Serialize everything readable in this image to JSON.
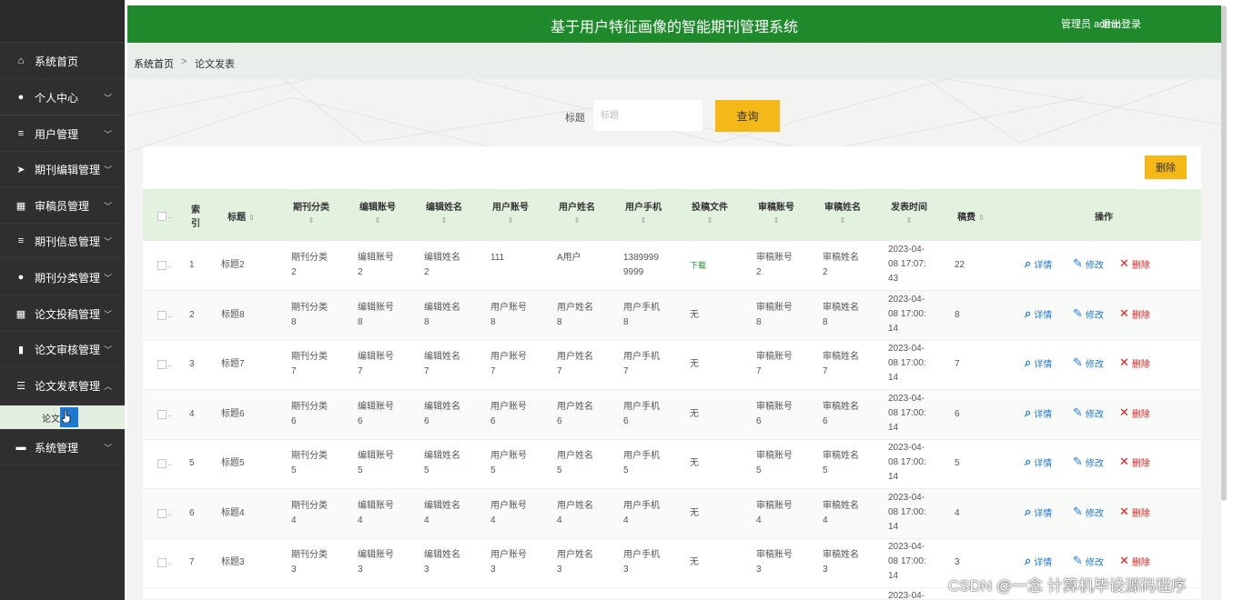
{
  "header": {
    "title": "基于用户特征画像的智能期刊管理系统",
    "user": "管理员 admin",
    "logout": "退出登录"
  },
  "sidebar": {
    "items": [
      {
        "label": "系统首页",
        "icon": "home-icon"
      },
      {
        "label": "个人中心",
        "icon": "user-icon"
      },
      {
        "label": "用户管理",
        "icon": "list-icon"
      },
      {
        "label": "期刊编辑管理",
        "icon": "send-icon"
      },
      {
        "label": "审稿员管理",
        "icon": "grid-icon"
      },
      {
        "label": "期刊信息管理",
        "icon": "list-icon"
      },
      {
        "label": "期刊分类管理",
        "icon": "user-icon"
      },
      {
        "label": "论文投稿管理",
        "icon": "grid-icon"
      },
      {
        "label": "论文审核管理",
        "icon": "chart-icon"
      },
      {
        "label": "论文发表管理",
        "icon": "sliders-icon"
      },
      {
        "label": "系统管理",
        "icon": "db-icon"
      }
    ],
    "sub_item": "论文发表"
  },
  "breadcrumb": {
    "home": "系统首页",
    "sep": ">",
    "current": "论文发表"
  },
  "search": {
    "label": "标题",
    "placeholder": "标题",
    "button": "查询"
  },
  "toolbar": {
    "delete": "删除"
  },
  "table": {
    "headers": {
      "index": "索引",
      "title": "标题",
      "category": "期刊分类",
      "editor_acc": "编辑账号",
      "editor_name": "编辑姓名",
      "user_acc": "用户账号",
      "user_name": "用户姓名",
      "user_phone": "用户手机",
      "file": "投稿文件",
      "reviewer_acc": "审稿账号",
      "reviewer_name": "审稿姓名",
      "time": "发表时间",
      "fee": "稿费",
      "ops": "操作"
    },
    "actions": {
      "detail": "详情",
      "edit": "修改",
      "delete": "删除"
    },
    "rows": [
      {
        "idx": "1",
        "title": "标题2",
        "category": [
          "期刊分类",
          "2"
        ],
        "editor_acc": [
          "编辑账号",
          "2"
        ],
        "editor_name": [
          "编辑姓名",
          "2"
        ],
        "user_acc": [
          "111",
          ""
        ],
        "user_name": [
          "A用户",
          ""
        ],
        "user_phone": [
          "1389999",
          "9999"
        ],
        "file": "下载",
        "reviewer_acc": [
          "审稿账号",
          "2"
        ],
        "reviewer_name": [
          "审稿姓名",
          "2"
        ],
        "time": [
          "2023-04-",
          "08 17:07:",
          "43"
        ],
        "fee": "22"
      },
      {
        "idx": "2",
        "title": "标题8",
        "category": [
          "期刊分类",
          "8"
        ],
        "editor_acc": [
          "编辑账号",
          "8"
        ],
        "editor_name": [
          "编辑姓名",
          "8"
        ],
        "user_acc": [
          "用户账号",
          "8"
        ],
        "user_name": [
          "用户姓名",
          "8"
        ],
        "user_phone": [
          "用户手机",
          "8"
        ],
        "file": "无",
        "reviewer_acc": [
          "审稿账号",
          "8"
        ],
        "reviewer_name": [
          "审稿姓名",
          "8"
        ],
        "time": [
          "2023-04-",
          "08 17:00:",
          "14"
        ],
        "fee": "8"
      },
      {
        "idx": "3",
        "title": "标题7",
        "category": [
          "期刊分类",
          "7"
        ],
        "editor_acc": [
          "编辑账号",
          "7"
        ],
        "editor_name": [
          "编辑姓名",
          "7"
        ],
        "user_acc": [
          "用户账号",
          "7"
        ],
        "user_name": [
          "用户姓名",
          "7"
        ],
        "user_phone": [
          "用户手机",
          "7"
        ],
        "file": "无",
        "reviewer_acc": [
          "审稿账号",
          "7"
        ],
        "reviewer_name": [
          "审稿姓名",
          "7"
        ],
        "time": [
          "2023-04-",
          "08 17:00:",
          "14"
        ],
        "fee": "7"
      },
      {
        "idx": "4",
        "title": "标题6",
        "category": [
          "期刊分类",
          "6"
        ],
        "editor_acc": [
          "编辑账号",
          "6"
        ],
        "editor_name": [
          "编辑姓名",
          "6"
        ],
        "user_acc": [
          "用户账号",
          "6"
        ],
        "user_name": [
          "用户姓名",
          "6"
        ],
        "user_phone": [
          "用户手机",
          "6"
        ],
        "file": "无",
        "reviewer_acc": [
          "审稿账号",
          "6"
        ],
        "reviewer_name": [
          "审稿姓名",
          "6"
        ],
        "time": [
          "2023-04-",
          "08 17:00:",
          "14"
        ],
        "fee": "6"
      },
      {
        "idx": "5",
        "title": "标题5",
        "category": [
          "期刊分类",
          "5"
        ],
        "editor_acc": [
          "编辑账号",
          "5"
        ],
        "editor_name": [
          "编辑姓名",
          "5"
        ],
        "user_acc": [
          "用户账号",
          "5"
        ],
        "user_name": [
          "用户姓名",
          "5"
        ],
        "user_phone": [
          "用户手机",
          "5"
        ],
        "file": "无",
        "reviewer_acc": [
          "审稿账号",
          "5"
        ],
        "reviewer_name": [
          "审稿姓名",
          "5"
        ],
        "time": [
          "2023-04-",
          "08 17:00:",
          "14"
        ],
        "fee": "5"
      },
      {
        "idx": "6",
        "title": "标题4",
        "category": [
          "期刊分类",
          "4"
        ],
        "editor_acc": [
          "编辑账号",
          "4"
        ],
        "editor_name": [
          "编辑姓名",
          "4"
        ],
        "user_acc": [
          "用户账号",
          "4"
        ],
        "user_name": [
          "用户姓名",
          "4"
        ],
        "user_phone": [
          "用户手机",
          "4"
        ],
        "file": "无",
        "reviewer_acc": [
          "审稿账号",
          "4"
        ],
        "reviewer_name": [
          "审稿姓名",
          "4"
        ],
        "time": [
          "2023-04-",
          "08 17:00:",
          "14"
        ],
        "fee": "4"
      },
      {
        "idx": "7",
        "title": "标题3",
        "category": [
          "期刊分类",
          "3"
        ],
        "editor_acc": [
          "编辑账号",
          "3"
        ],
        "editor_name": [
          "编辑姓名",
          "3"
        ],
        "user_acc": [
          "用户账号",
          "3"
        ],
        "user_name": [
          "用户姓名",
          "3"
        ],
        "user_phone": [
          "用户手机",
          "3"
        ],
        "file": "无",
        "reviewer_acc": [
          "审稿账号",
          "3"
        ],
        "reviewer_name": [
          "审稿姓名",
          "3"
        ],
        "time": [
          "2023-04-",
          "08 17:00:",
          "14"
        ],
        "fee": "3"
      }
    ],
    "partial_row_time": "2023-04-"
  },
  "watermark": "CSDN @一念 计算机毕设源码程序",
  "colors": {
    "header_green": "#1e8a2b",
    "sidebar_dark": "#2f2f2f",
    "accent_yellow": "#f5b917",
    "link_blue": "#1f78d1",
    "delete_red": "#e02020"
  }
}
